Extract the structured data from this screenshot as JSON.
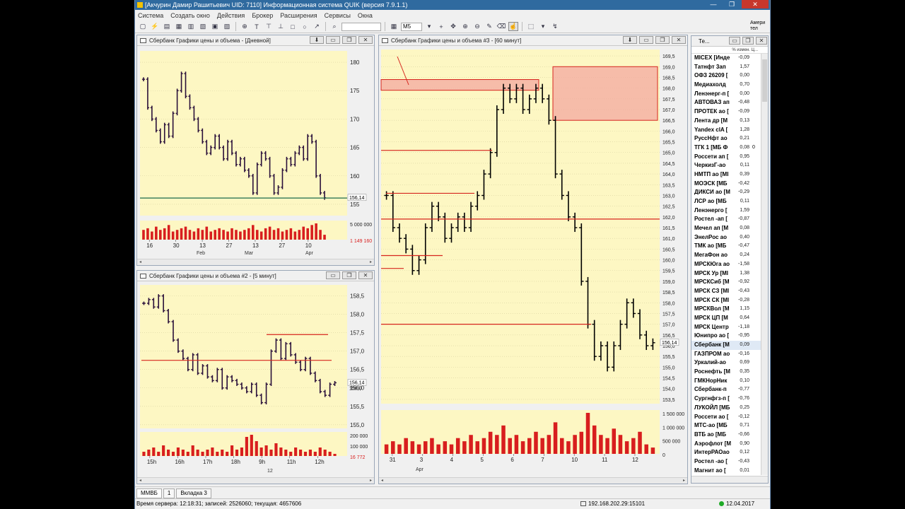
{
  "window": {
    "title": "[Акчурин Дамир Рашитьевич UID: 7110] Информационная система QUIK (версия 7.9.1.1)",
    "buttons": [
      "—",
      "❐",
      "✕"
    ]
  },
  "menu": [
    "Система",
    "Создать окно",
    "Действия",
    "Брокер",
    "Расширения",
    "Сервисы",
    "Окна"
  ],
  "toolbar": {
    "interval": "M5",
    "right_text": "Амери тел"
  },
  "colors": {
    "chart_bg": "#fdf7c3",
    "candle": "#2a103a",
    "candle_right": "#000000",
    "level_line": "#d6261e",
    "zone_fill": "#f3a8a0",
    "volume": "#d81e1e",
    "support_line": "#1b6b4b"
  },
  "panels": {
    "daily": {
      "title": "Сбербанк Графики цены и объема - [Дневной]",
      "price_label": "156,14",
      "volume_labels": [
        "5 000 000",
        "1 149 160"
      ],
      "x_labels": [
        "16",
        "30",
        "13",
        "27",
        "13",
        "27",
        "10"
      ],
      "x_sublabels": [
        "Feb",
        "Mar",
        "Apr"
      ]
    },
    "m5": {
      "title": "Сбербанк Графики цены и объема #2 - [5 минут]",
      "price_label": "156,14",
      "price_label2": "156,0",
      "volume_labels": [
        "200 000",
        "100 000",
        "16 772"
      ],
      "x_labels": [
        "15h",
        "16h",
        "17h",
        "18h",
        "9h",
        "11h",
        "12h"
      ],
      "x_sublabel": "12"
    },
    "h1": {
      "title": "Сбербанк Графики цены и объема #3 - [60 минут]",
      "price_label": "156,14",
      "volume_labels": [
        "1 500 000",
        "1 000 000",
        "500 000",
        "0"
      ],
      "x_labels": [
        "31",
        "3",
        "4",
        "5",
        "6",
        "7",
        "10",
        "11",
        "12"
      ],
      "x_sublabel": "Apr"
    }
  },
  "chart_data": [
    {
      "type": "candlestick",
      "title": "Сбербанк Графики цены и объема - [Дневной]",
      "ylim": [
        153,
        182
      ],
      "yticks": [
        155,
        160,
        165,
        170,
        175,
        180
      ],
      "last_price": 156.14,
      "close": [
        177,
        172,
        170,
        168,
        166,
        169,
        167,
        171,
        175,
        178,
        174,
        172,
        170,
        168,
        166,
        164,
        165,
        167,
        165,
        163,
        166,
        164,
        162,
        163,
        161,
        160,
        157,
        162,
        164,
        163,
        160,
        157,
        158,
        161,
        163,
        162,
        164,
        165,
        163,
        167,
        166,
        160,
        157,
        156.14
      ],
      "volumes_relative": [
        0.6,
        0.7,
        0.5,
        0.8,
        0.6,
        0.7,
        0.9,
        0.5,
        0.6,
        0.7,
        0.8,
        0.6,
        0.5,
        0.7,
        0.6,
        0.8,
        0.5,
        0.6,
        0.7,
        0.6,
        0.5,
        0.7,
        0.6,
        0.5,
        0.6,
        0.7,
        0.9,
        0.6,
        0.5,
        0.7,
        0.8,
        0.6,
        0.7,
        0.5,
        0.6,
        0.7,
        0.5,
        0.6,
        0.8,
        0.7,
        0.9,
        1.0,
        0.6,
        0.3
      ]
    },
    {
      "type": "candlestick",
      "title": "Сбербанк Графики цены и объема #2 - [5 минут]",
      "ylim": [
        154.9,
        158.8
      ],
      "yticks": [
        155.0,
        155.5,
        156.0,
        156.5,
        157.0,
        157.5,
        158.0,
        158.5
      ],
      "last_price": 156.14,
      "horizontal_levels": [
        156.75,
        157.45
      ],
      "close": [
        158.3,
        158.4,
        158.2,
        158.5,
        158.1,
        157.8,
        157.3,
        157.0,
        156.8,
        156.5,
        156.9,
        156.4,
        156.6,
        156.3,
        156.2,
        156.5,
        156.0,
        156.3,
        156.2,
        156.1,
        156.0,
        155.9,
        156.1,
        155.8,
        155.6,
        156.1,
        157.0,
        157.3,
        156.8,
        157.2,
        156.9,
        156.7,
        156.5,
        156.8,
        156.4,
        156.2,
        155.9,
        155.8,
        156.1,
        156.14
      ],
      "volumes_relative": [
        0.2,
        0.3,
        0.4,
        0.2,
        0.5,
        0.3,
        0.2,
        0.4,
        0.3,
        0.2,
        0.5,
        0.3,
        0.2,
        0.3,
        0.4,
        0.2,
        0.3,
        0.2,
        0.5,
        0.3,
        0.4,
        0.9,
        1.0,
        0.7,
        0.4,
        0.5,
        0.3,
        0.6,
        0.4,
        0.3,
        0.2,
        0.4,
        0.3,
        0.2,
        0.3,
        0.2,
        0.4,
        0.3,
        0.2,
        0.1
      ]
    },
    {
      "type": "candlestick",
      "title": "Сбербанк Графики цены и объема #3 - [60 минут]",
      "ylim": [
        153.3,
        169.8
      ],
      "yticks": [
        153.5,
        154.0,
        154.5,
        155.0,
        155.5,
        156.0,
        156.5,
        157.0,
        157.5,
        158.0,
        158.5,
        159.0,
        159.5,
        160.0,
        160.5,
        161.0,
        161.5,
        162.0,
        162.5,
        163.0,
        163.5,
        164.0,
        164.5,
        165.0,
        165.5,
        166.0,
        166.5,
        167.0,
        167.5,
        168.0,
        168.5,
        169.0,
        169.5
      ],
      "last_price": 156.14,
      "horizontal_levels": [
        165.1,
        163.1,
        161.9,
        160.2,
        159.6,
        157.0
      ],
      "zones": [
        {
          "price_low": 167.9,
          "price_high": 168.4
        },
        {
          "price_low": 166.5,
          "price_high": 169.0
        }
      ],
      "close": [
        163.0,
        161.5,
        161.0,
        160.5,
        159.5,
        160.0,
        161.5,
        162.5,
        162.0,
        161.0,
        161.5,
        162.0,
        161.5,
        162.5,
        163.0,
        164.0,
        165.0,
        167.0,
        168.0,
        167.5,
        168.0,
        167.0,
        167.5,
        168.0,
        167.5,
        166.5,
        164.0,
        163.0,
        162.0,
        161.5,
        159.0,
        157.0,
        155.5,
        156.0,
        155.0,
        156.0,
        157.0,
        158.0,
        157.5,
        156.5,
        156.0,
        156.14
      ],
      "volumes_relative": [
        0.3,
        0.4,
        0.3,
        0.5,
        0.4,
        0.3,
        0.4,
        0.5,
        0.3,
        0.4,
        0.3,
        0.5,
        0.4,
        0.6,
        0.4,
        0.5,
        0.7,
        0.6,
        0.9,
        0.5,
        0.6,
        0.4,
        0.5,
        0.7,
        0.5,
        0.6,
        1.0,
        0.5,
        0.4,
        0.6,
        0.7,
        1.3,
        0.9,
        0.6,
        0.5,
        0.8,
        0.6,
        0.4,
        0.5,
        0.7,
        0.3,
        0.2
      ]
    }
  ],
  "right_panel": {
    "title": "Те...",
    "header": "% измен. Ц...",
    "rows": [
      {
        "name": "MICEX [Инде",
        "change": "-0,09"
      },
      {
        "name": "Татнфт 3ап",
        "change": "1,57"
      },
      {
        "name": "ОФЗ 26209 [",
        "change": "0,00"
      },
      {
        "name": "Медиахолд",
        "change": "0,70"
      },
      {
        "name": "Ленэнерг-п [",
        "change": "0,00"
      },
      {
        "name": "АВТОВАЗ ап",
        "change": "-0,48"
      },
      {
        "name": "ПРОТЕК ао [",
        "change": "-0,09"
      },
      {
        "name": "Лента др [М",
        "change": "0,13"
      },
      {
        "name": "Yandex clA [",
        "change": "1,28"
      },
      {
        "name": "РуссНфт ао",
        "change": "0,21"
      },
      {
        "name": "ТГК 1 [МБ Ф",
        "change": "0,08",
        "extra": "0"
      },
      {
        "name": "Россети ап [",
        "change": "0,95"
      },
      {
        "name": "ЧеркизГ-ао",
        "change": "0,11"
      },
      {
        "name": "НМТП ао [МІ",
        "change": "0,39"
      },
      {
        "name": "МОЭСК [МБ",
        "change": "-0,42"
      },
      {
        "name": "ДИКСИ ао [М",
        "change": "-0,29"
      },
      {
        "name": "ЛСР ао [МБ",
        "change": "0,11"
      },
      {
        "name": "Ленэнерго [",
        "change": "1,59"
      },
      {
        "name": "Ростел -ап [",
        "change": "-0,87"
      },
      {
        "name": "Мечел ап [М",
        "change": "0,08"
      },
      {
        "name": "ЭнелРос ао",
        "change": "0,40"
      },
      {
        "name": "ТМК ао [МБ",
        "change": "-0,47"
      },
      {
        "name": "МегаФон ао",
        "change": "0,24"
      },
      {
        "name": "МРСКЮга ао",
        "change": "-1,58"
      },
      {
        "name": "МРСК Ур [МІ",
        "change": "1,38"
      },
      {
        "name": "МРСКСиб [М",
        "change": "-0,92"
      },
      {
        "name": "МРСК СЗ [МІ",
        "change": "-0,43"
      },
      {
        "name": "МРСК СК [МІ",
        "change": "-0,28"
      },
      {
        "name": "МРСКВол [М",
        "change": "1,15"
      },
      {
        "name": "МРСК ЦП [М",
        "change": "0,64"
      },
      {
        "name": "МРСК Центр",
        "change": "-1,18"
      },
      {
        "name": "Юнипро ао [",
        "change": "-0,95"
      },
      {
        "name": "Сбербанк [М",
        "change": "0,09",
        "selected": true
      },
      {
        "name": "ГАЗПРОМ ао",
        "change": "-0,16"
      },
      {
        "name": "Уркалий-ао",
        "change": "0,69"
      },
      {
        "name": "Роснефть [М",
        "change": "0,35"
      },
      {
        "name": "ГМКНорНик",
        "change": "0,10"
      },
      {
        "name": "Сбербанк-п",
        "change": "-0,77"
      },
      {
        "name": "Сургнфгз-п [",
        "change": "-0,76"
      },
      {
        "name": "ЛУКОЙЛ [МБ",
        "change": "0,25"
      },
      {
        "name": "Россети ао [",
        "change": "-0,12"
      },
      {
        "name": "МТС-ао [МБ",
        "change": "0,71"
      },
      {
        "name": "ВТБ ао [МБ",
        "change": "-0,66"
      },
      {
        "name": "Аэрофлот [М",
        "change": "0,90"
      },
      {
        "name": "ИнтерРАОао",
        "change": "0,12"
      },
      {
        "name": "Ростел -ао [",
        "change": "-0,43"
      },
      {
        "name": "Магнит ао [",
        "change": "0,01"
      }
    ]
  },
  "tabs": [
    "ММВБ",
    "1",
    "Вкладка 3"
  ],
  "status": {
    "server": "Время сервера: 12:18:31; записей: 2526060; текущая: 4657606",
    "network": "192.168.202.29:15101",
    "date": "12.04.2017"
  }
}
